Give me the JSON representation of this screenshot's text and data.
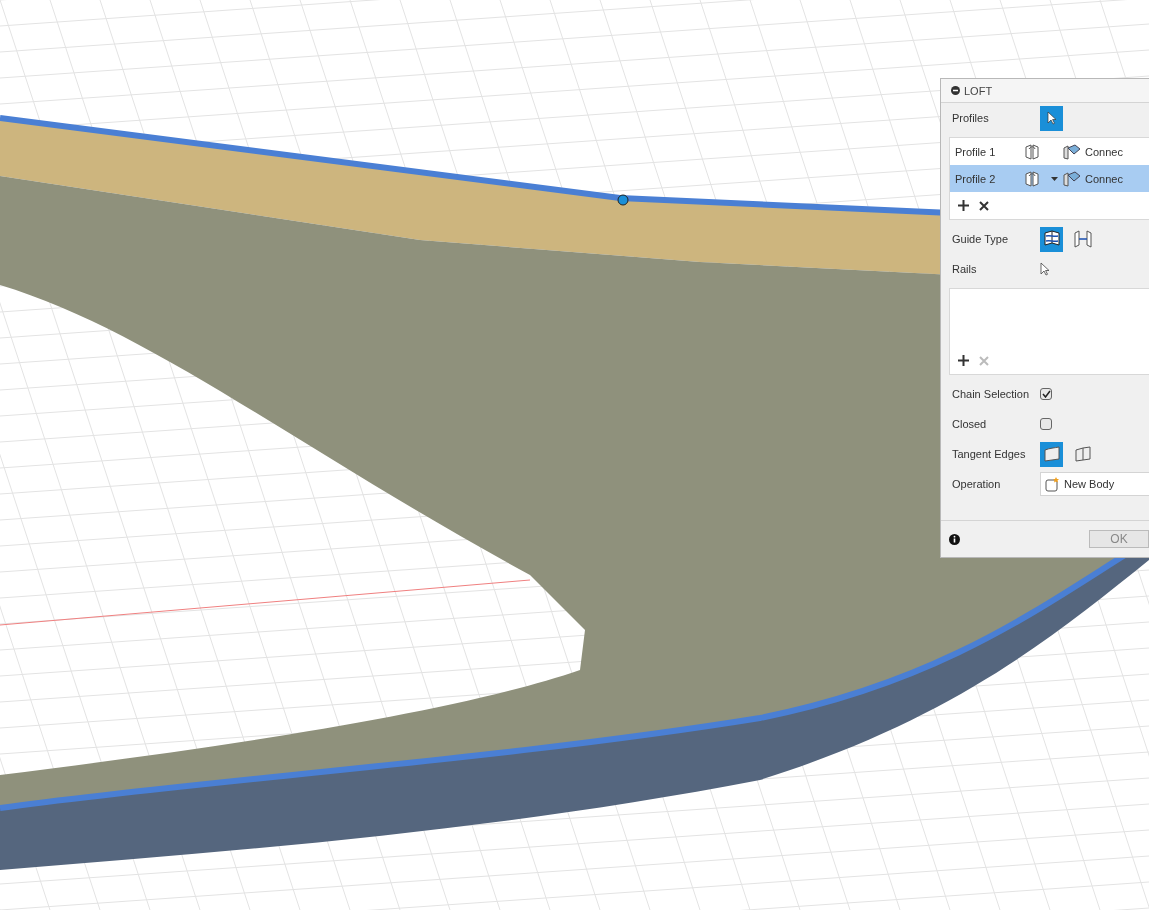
{
  "dialog": {
    "title": "LOFT",
    "profiles_label": "Profiles",
    "profiles": [
      {
        "name": "Profile 1",
        "end_condition": "Connec",
        "selected": false
      },
      {
        "name": "Profile 2",
        "end_condition": "Connec",
        "selected": true
      }
    ],
    "profiles_remove_disabled": false,
    "guide_type": {
      "label": "Guide Type",
      "options": [
        {
          "kind": "rails",
          "selected": true
        },
        {
          "kind": "centerline",
          "selected": false
        }
      ]
    },
    "rails": {
      "label": "Rails",
      "remove_disabled": true
    },
    "options": [
      {
        "label": "Chain Selection",
        "checked": true
      },
      {
        "label": "Closed",
        "checked": false
      }
    ],
    "tangent_edges": {
      "label": "Tangent Edges",
      "options": [
        {
          "kind": "merge",
          "selected": true
        },
        {
          "kind": "keep",
          "selected": false
        }
      ]
    },
    "operation": {
      "label": "Operation",
      "value": "New Body"
    },
    "ok": "OK"
  }
}
